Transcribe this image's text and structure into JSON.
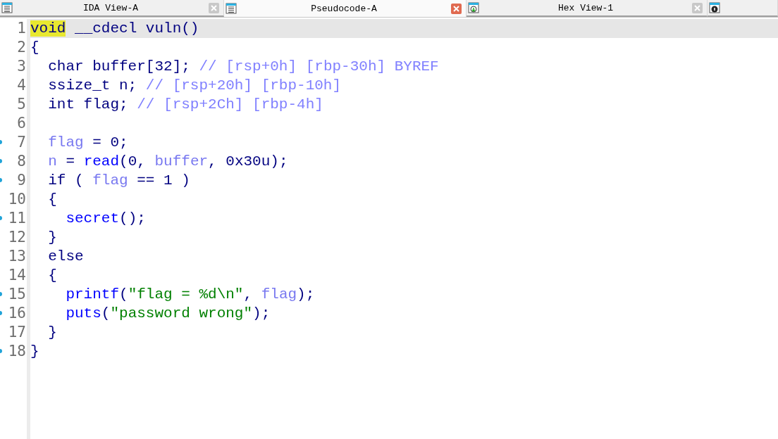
{
  "tabs": [
    {
      "label": "IDA View-A",
      "kind": "listing",
      "selected": false,
      "closable": true
    },
    {
      "label": "Pseudocode-A",
      "kind": "listing",
      "selected": true,
      "closable": true
    },
    {
      "label": "Hex View-1",
      "kind": "hex",
      "selected": false,
      "closable": true
    },
    {
      "kind": "info",
      "selected": false,
      "closable": false
    }
  ],
  "lines": [
    {
      "number": "1",
      "marker": false,
      "current": true,
      "tokens": [
        {
          "kind": "keyword",
          "text": "void",
          "highlighted": true
        },
        {
          "kind": "plain",
          "text": " __cdecl vuln()"
        }
      ]
    },
    {
      "number": "2",
      "marker": false,
      "current": false,
      "tokens": [
        {
          "kind": "plain",
          "text": "{"
        }
      ]
    },
    {
      "number": "3",
      "marker": false,
      "current": false,
      "tokens": [
        {
          "kind": "plain",
          "text": "  char buffer[32]; "
        },
        {
          "kind": "comment",
          "text": "// [rsp+0h] [rbp-30h] BYREF"
        }
      ]
    },
    {
      "number": "4",
      "marker": false,
      "current": false,
      "tokens": [
        {
          "kind": "plain",
          "text": "  ssize_t n; "
        },
        {
          "kind": "comment",
          "text": "// [rsp+20h] [rbp-10h]"
        }
      ]
    },
    {
      "number": "5",
      "marker": false,
      "current": false,
      "tokens": [
        {
          "kind": "plain",
          "text": "  int flag; "
        },
        {
          "kind": "comment",
          "text": "// [rsp+2Ch] [rbp-4h]"
        }
      ]
    },
    {
      "number": "6",
      "marker": false,
      "current": false
    },
    {
      "number": "7",
      "marker": true,
      "current": false,
      "tokens": [
        {
          "kind": "variable",
          "text": "  flag"
        },
        {
          "kind": "plain",
          "text": " = 0;"
        }
      ]
    },
    {
      "number": "8",
      "marker": true,
      "current": false,
      "tokens": [
        {
          "kind": "variable",
          "text": "  n"
        },
        {
          "kind": "plain",
          "text": " = "
        },
        {
          "kind": "call",
          "text": "read"
        },
        {
          "kind": "plain",
          "text": "(0, "
        },
        {
          "kind": "variable",
          "text": "buffer"
        },
        {
          "kind": "plain",
          "text": ", 0x30u);"
        }
      ]
    },
    {
      "number": "9",
      "marker": true,
      "current": false,
      "tokens": [
        {
          "kind": "plain",
          "text": "  if ( "
        },
        {
          "kind": "variable",
          "text": "flag"
        },
        {
          "kind": "plain",
          "text": " == 1 )"
        }
      ]
    },
    {
      "number": "10",
      "marker": false,
      "current": false,
      "tokens": [
        {
          "kind": "plain",
          "text": "  {"
        }
      ]
    },
    {
      "number": "11",
      "marker": true,
      "current": false,
      "tokens": [
        {
          "kind": "call",
          "text": "    secret"
        },
        {
          "kind": "plain",
          "text": "();"
        }
      ]
    },
    {
      "number": "12",
      "marker": false,
      "current": false,
      "tokens": [
        {
          "kind": "plain",
          "text": "  }"
        }
      ]
    },
    {
      "number": "13",
      "marker": false,
      "current": false,
      "tokens": [
        {
          "kind": "plain",
          "text": "  else"
        }
      ]
    },
    {
      "number": "14",
      "marker": false,
      "current": false,
      "tokens": [
        {
          "kind": "plain",
          "text": "  {"
        }
      ]
    },
    {
      "number": "15",
      "marker": true,
      "current": false,
      "tokens": [
        {
          "kind": "call",
          "text": "    printf"
        },
        {
          "kind": "plain",
          "text": "("
        },
        {
          "kind": "string",
          "text": "\"flag = %d\\n\""
        },
        {
          "kind": "plain",
          "text": ", "
        },
        {
          "kind": "variable",
          "text": "flag"
        },
        {
          "kind": "plain",
          "text": ");"
        }
      ]
    },
    {
      "number": "16",
      "marker": true,
      "current": false,
      "tokens": [
        {
          "kind": "call",
          "text": "    puts"
        },
        {
          "kind": "plain",
          "text": "("
        },
        {
          "kind": "string",
          "text": "\"password wrong\""
        },
        {
          "kind": "plain",
          "text": ");"
        }
      ]
    },
    {
      "number": "17",
      "marker": false,
      "current": false,
      "tokens": [
        {
          "kind": "plain",
          "text": "  }"
        }
      ]
    },
    {
      "number": "18",
      "marker": true,
      "current": false,
      "tokens": [
        {
          "kind": "plain",
          "text": "}"
        }
      ]
    }
  ]
}
